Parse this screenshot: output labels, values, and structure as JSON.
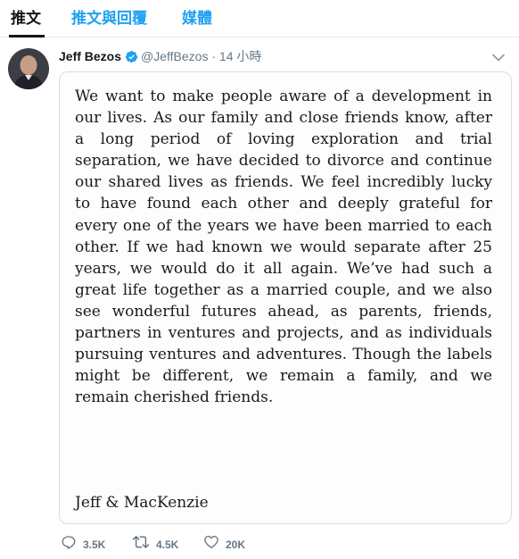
{
  "tabs": [
    {
      "label": "推文"
    },
    {
      "label": "推文與回覆"
    },
    {
      "label": "媒體"
    }
  ],
  "tweet": {
    "author_name": "Jeff Bezos",
    "handle": "@JeffBezos",
    "separator": "·",
    "time": "14 小時",
    "letter_text": "We want to make people aware of a development in our lives. As our family and close friends know, after a long period of loving exploration and trial separation, we have decided to divorce and continue our shared lives as friends.  We feel incredibly lucky to have found each other and deeply grateful for every one of the years we have been married to each other.  If we had known we would separate after 25 years, we would do it all again.  We’ve had such a great life together as a married couple, and we also see wonderful futures ahead, as parents, friends, partners in ventures and projects, and as individuals pursuing ventures and adventures.  Though the labels might be different, we remain a family, and we remain cherished friends.",
    "signature": "Jeff & MacKenzie"
  },
  "actions": {
    "reply_count": "3.5K",
    "retweet_count": "4.5K",
    "like_count": "20K"
  },
  "colors": {
    "accent": "#1da1f2",
    "muted": "#657786",
    "text": "#14171a",
    "border": "#e6ecf0"
  }
}
